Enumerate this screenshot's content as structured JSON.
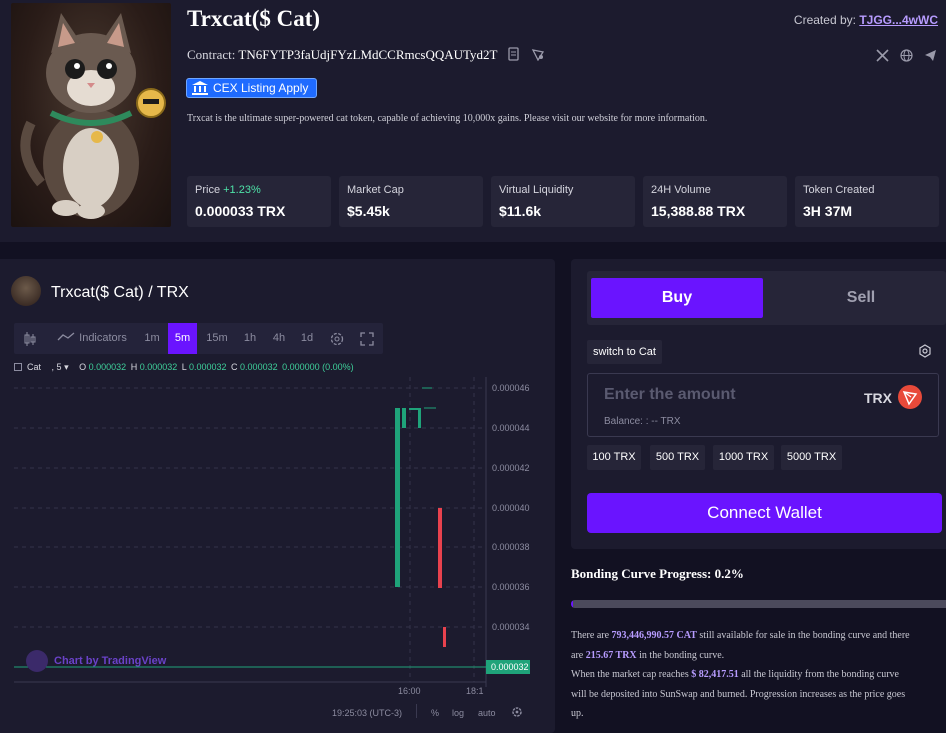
{
  "token": {
    "title": "Trxcat($ Cat)",
    "contract_label": "Contract:",
    "contract_address": "TN6FYTP3faUdjFYzLMdCCRmcsQQAUTyd2T",
    "cex_label": "CEX Listing Apply",
    "description": "Trxcat is the ultimate super-powered cat token, capable of achieving 10,000x gains. Please visit our website for more information.",
    "created_by_label": "Created by:",
    "creator": "TJGG...4wWC"
  },
  "stats": [
    {
      "label": "Price",
      "change": "+1.23%",
      "value": "0.000033 TRX"
    },
    {
      "label": "Market Cap",
      "value": "$5.45k"
    },
    {
      "label": "Virtual Liquidity",
      "value": "$11.6k"
    },
    {
      "label": "24H Volume",
      "value": "15,388.88 TRX"
    },
    {
      "label": "Token Created",
      "value": "3H 37M"
    }
  ],
  "chart": {
    "pair_title": "Trxcat($ Cat) / TRX",
    "toolbar": {
      "indicators": "Indicators",
      "intervals": [
        "1m",
        "5m",
        "15m",
        "1h",
        "4h",
        "1d"
      ],
      "active_interval": "5m"
    },
    "legend": {
      "symbol": "Cat",
      "interval": ", 5",
      "o_label": "O",
      "o": "0.000032",
      "h_label": "H",
      "h": "0.000032",
      "l_label": "L",
      "l": "0.000032",
      "c_label": "C",
      "c": "0.000032",
      "change": "0.000000 (0.00%)"
    },
    "price_labels": [
      "0.000046",
      "0.000044",
      "0.000042",
      "0.000040",
      "0.000038",
      "0.000036",
      "0.000034"
    ],
    "current_price": "0.000032",
    "time_labels": [
      "16:00",
      "18:1"
    ],
    "tv_credit": "Chart by TradingView",
    "clock": "19:25:03 (UTC-3)",
    "percent": "%",
    "log": "log",
    "auto": "auto",
    "colors": {
      "up": "#1fa37a",
      "down": "#e8424e"
    }
  },
  "trade": {
    "buy_label": "Buy",
    "sell_label": "Sell",
    "switch_label": "switch to Cat",
    "amount_placeholder": "Enter the amount",
    "currency": "TRX",
    "balance": "Balance: : -- TRX",
    "quick_amounts": [
      "100 TRX",
      "500 TRX",
      "1000 TRX",
      "5000 TRX"
    ],
    "connect_label": "Connect Wallet"
  },
  "bonding": {
    "title": "Bonding Curve Progress: 0.2%",
    "progress": 0.002,
    "line1a": "There are ",
    "line1b": "793,446,990.57 CAT",
    "line1c": " still available for sale in the bonding curve and there",
    "line2a": "are ",
    "line2b": "215.67 TRX",
    "line2c": " in the bonding curve.",
    "line3a": "When the market cap reaches ",
    "line3b": "$ 82,417.51",
    "line3c": " all the liquidity from the bonding curve",
    "line4": "will be deposited into SunSwap and burned. Progression increases as the price goes",
    "line5": "up."
  }
}
